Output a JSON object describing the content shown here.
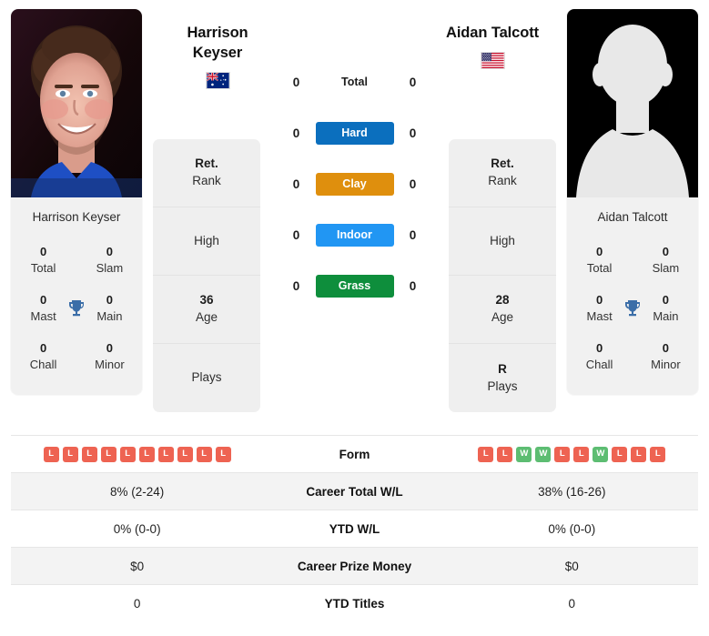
{
  "players": {
    "left": {
      "name": "Harrison Keyser",
      "name_line1": "Harrison",
      "name_line2": "Keyser",
      "photo_caption": "Harrison Keyser",
      "country": "Australia",
      "flag_icon": "flag-australia-icon",
      "photo_type": "portrait-photo",
      "titles": [
        {
          "value": "0",
          "label": "Total"
        },
        {
          "value": "0",
          "label": "Slam"
        },
        {
          "value": "0",
          "label": "Mast"
        },
        {
          "value": "0",
          "label": "Main"
        },
        {
          "value": "0",
          "label": "Chall"
        },
        {
          "value": "0",
          "label": "Minor"
        }
      ],
      "info": [
        {
          "value": "Ret.",
          "label": "Rank"
        },
        {
          "value": "",
          "label": "High"
        },
        {
          "value": "36",
          "label": "Age"
        },
        {
          "value": "",
          "label": "Plays"
        }
      ],
      "surface_wins": {
        "total": "0",
        "hard": "0",
        "clay": "0",
        "indoor": "0",
        "grass": "0"
      },
      "form": [
        "L",
        "L",
        "L",
        "L",
        "L",
        "L",
        "L",
        "L",
        "L",
        "L"
      ],
      "career_total_wl": "8% (2-24)",
      "ytd_wl": "0% (0-0)",
      "career_prize_money": "$0",
      "ytd_titles": "0"
    },
    "right": {
      "name": "Aidan Talcott",
      "name_line1": "Aidan Talcott",
      "name_line2": "",
      "photo_caption": "Aidan Talcott",
      "country": "United States",
      "flag_icon": "flag-usa-icon",
      "photo_type": "placeholder-silhouette",
      "titles": [
        {
          "value": "0",
          "label": "Total"
        },
        {
          "value": "0",
          "label": "Slam"
        },
        {
          "value": "0",
          "label": "Mast"
        },
        {
          "value": "0",
          "label": "Main"
        },
        {
          "value": "0",
          "label": "Chall"
        },
        {
          "value": "0",
          "label": "Minor"
        }
      ],
      "info": [
        {
          "value": "Ret.",
          "label": "Rank"
        },
        {
          "value": "",
          "label": "High"
        },
        {
          "value": "28",
          "label": "Age"
        },
        {
          "value": "R",
          "label": "Plays"
        }
      ],
      "surface_wins": {
        "total": "0",
        "hard": "0",
        "clay": "0",
        "indoor": "0",
        "grass": "0"
      },
      "form": [
        "L",
        "L",
        "W",
        "W",
        "L",
        "L",
        "W",
        "L",
        "L",
        "L"
      ],
      "career_total_wl": "38% (16-26)",
      "ytd_wl": "0% (0-0)",
      "career_prize_money": "$0",
      "ytd_titles": "0"
    }
  },
  "surfaces": [
    {
      "key": "total",
      "label": "Total",
      "color": "transparent",
      "text_color": "#1c1c1c"
    },
    {
      "key": "hard",
      "label": "Hard",
      "color": "#0B6FBE",
      "text_color": "#ffffff"
    },
    {
      "key": "clay",
      "label": "Clay",
      "color": "#DF8F0D",
      "text_color": "#ffffff"
    },
    {
      "key": "indoor",
      "label": "Indoor",
      "color": "#2196F3",
      "text_color": "#ffffff"
    },
    {
      "key": "grass",
      "label": "Grass",
      "color": "#0E8E3C",
      "text_color": "#ffffff"
    }
  ],
  "table": {
    "rows": [
      {
        "label": "Form",
        "key": "form"
      },
      {
        "label": "Career Total W/L",
        "key": "career_total_wl"
      },
      {
        "label": "YTD W/L",
        "key": "ytd_wl"
      },
      {
        "label": "Career Prize Money",
        "key": "career_prize_money"
      },
      {
        "label": "YTD Titles",
        "key": "ytd_titles"
      }
    ]
  },
  "colors": {
    "win_badge": "#5DBD72",
    "loss_badge": "#EE6352",
    "trophy": "#3B6EA8",
    "card_bg": "#f1f1f1",
    "row_shaded": "#f3f3f3"
  },
  "icons": {
    "trophy": "trophy-icon"
  }
}
